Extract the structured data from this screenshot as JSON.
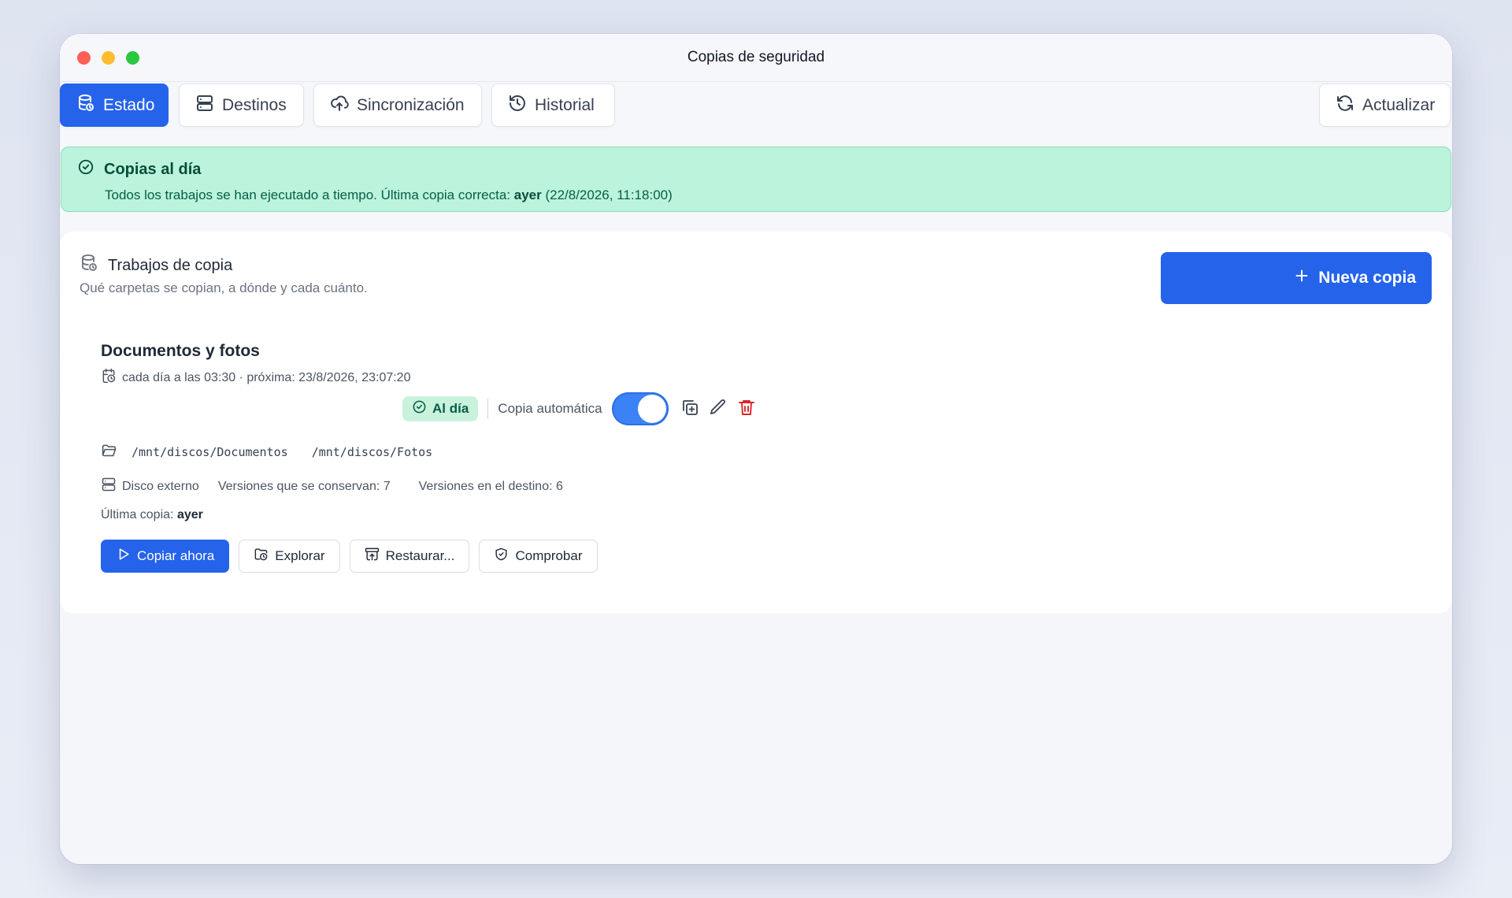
{
  "window": {
    "title": "Copias de seguridad"
  },
  "tabs": [
    {
      "label": "Estado",
      "icon": "database-history-icon",
      "active": true
    },
    {
      "label": "Destinos",
      "icon": "server-icon",
      "active": false
    },
    {
      "label": "Sincronización",
      "icon": "cloud-upload-icon",
      "active": false
    },
    {
      "label": "Historial",
      "icon": "history-icon",
      "active": false
    }
  ],
  "refresh_label": "Actualizar",
  "banner": {
    "title": "Copias al día",
    "text_prefix": "Todos los trabajos se han ejecutado a tiempo. Última copia correcta:",
    "text_bold": "ayer",
    "text_suffix": "(22/8/2026, 11:18:00)",
    "color": "#bcf3dc"
  },
  "jobs_section": {
    "title": "Trabajos de copia",
    "subtitle": "Qué carpetas se copian, a dónde y cada cuánto.",
    "new_button": "Nueva copia"
  },
  "job": {
    "name": "Documentos y fotos",
    "schedule": "cada día a las 03:30 · próxima: 23/8/2026, 23:07:20",
    "status": "Al día",
    "auto_label": "Copia automática",
    "auto_enabled": true,
    "paths": [
      "/mnt/discos/Documentos",
      "/mnt/discos/Fotos"
    ],
    "destination": "Disco externo",
    "versions_kept": "Versiones que se conservan: 7",
    "versions_dest": "Versiones en el destino: 6",
    "last_copy_label": "Última copia:",
    "last_copy_value": "ayer",
    "actions": {
      "copy_now": "Copiar ahora",
      "explore": "Explorar",
      "restore": "Restaurar...",
      "verify": "Comprobar"
    }
  },
  "colors": {
    "accent": "#2563eb",
    "success": "#065f46",
    "danger": "#dc2626"
  }
}
